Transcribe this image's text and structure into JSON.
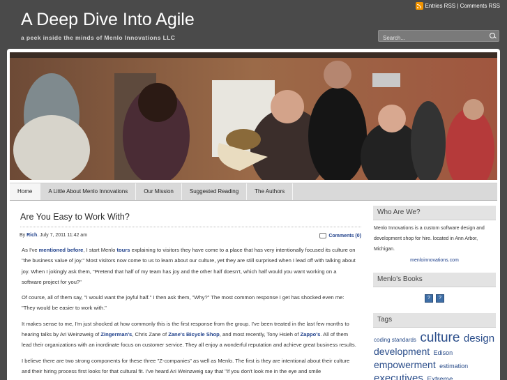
{
  "header": {
    "title": "A Deep Dive Into Agile",
    "tagline": "a peek inside the minds of Menlo Innovations LLC",
    "rss_text": "Entries RSS | Comments RSS",
    "search_placeholder": "Search..."
  },
  "nav": {
    "items": [
      {
        "label": "Home"
      },
      {
        "label": "A Little About Menlo Innovations"
      },
      {
        "label": "Our Mission"
      },
      {
        "label": "Suggested Reading"
      },
      {
        "label": "The Authors"
      }
    ]
  },
  "post": {
    "title": "Are You Easy to Work With?",
    "meta_by": "By",
    "meta_author": "Rich",
    "meta_date": ". July 7, 2011 11:42 am",
    "comments": "Comments (0)",
    "p1": {
      "t1": "As I've ",
      "link1": "mentioned before",
      "t2": ", I start Menlo ",
      "link2": "tours",
      "t3": " explaining to visitors they have come to a place that has very intentionally focused its culture on \"the business value of joy.\" Most visitors now come to us to learn about our culture, yet they are still surprised when I lead off with talking about joy. When I jokingly ask them, \"Pretend that half of my team has joy and the other half doesn't, which half would you want working on a software project for you?\""
    },
    "p2": "Of course, all of them say, \"I would want the joyful half.\" I then ask them, \"Why?\" The most common response I get has shocked even me: \"They would be easier to work with.\"",
    "p3": {
      "t1": "It makes sense to me, I'm just shocked at how commonly this is the first response from the group. I've been treated in the last few months to hearing talks by Ari Weinzweig of ",
      "link1": "Zingerman's",
      "t2": ", Chris Zane of ",
      "link2": "Zane's Bicycle Shop",
      "t3": ", and most recently, Tony Hsieh of ",
      "link3": "Zappo's",
      "t4": ". All of them lead their organizations with an inordinate focus on customer service. They all enjoy a wonderful reputation and achieve great business results."
    },
    "p4": "I believe there are two strong components for these three \"Z-companies\" as well as Menlo. The first is they are intentional about their culture and their hiring process first looks for that cultural fit. I've heard Ari Weinzweig say that \"If you don't look me in the eye and smile"
  },
  "sidebar": {
    "who_title": "Who Are We?",
    "who_text": "Menlo Innovations is a custom software design and development shop for hire. located in Ann Arbor, Michigan.",
    "who_link": "menloinnovations.com",
    "books_title": "Menlo's Books",
    "book_glyph": "?",
    "tags_title": "Tags",
    "tags": [
      {
        "label": "coding standards",
        "size": 8
      },
      {
        "label": "culture",
        "size": 19
      },
      {
        "label": "design",
        "size": 15
      },
      {
        "label": "development",
        "size": 14
      },
      {
        "label": "Edison",
        "size": 9
      },
      {
        "label": "empowerment",
        "size": 14
      },
      {
        "label": "estimation",
        "size": 9
      },
      {
        "label": "executives",
        "size": 15
      },
      {
        "label": "Extreme",
        "size": 10
      }
    ]
  },
  "colors": {
    "link": "#1e3f8a",
    "header_bg": "#4a4a4a",
    "rss": "#f29400"
  }
}
